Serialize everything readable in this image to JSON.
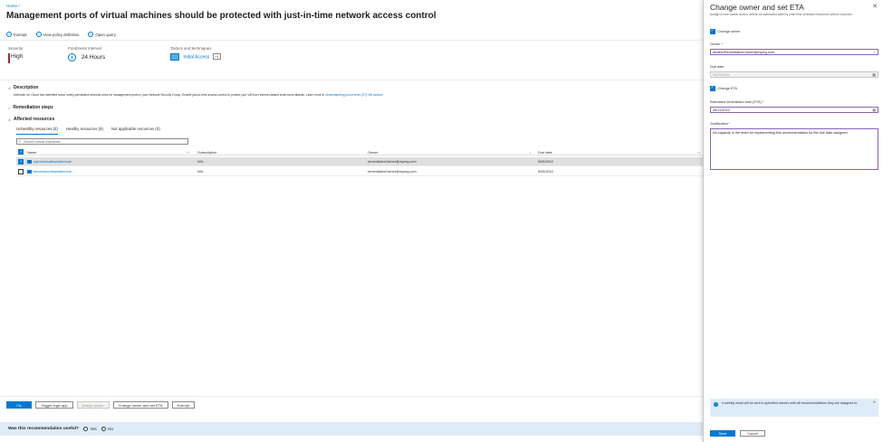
{
  "breadcrumb": "Home  /",
  "title": "Management ports of virtual machines should be protected with just-in-time network access control",
  "title_more": "...",
  "toolbar": {
    "exempt": "Exempt",
    "view_policy": "View policy definition",
    "open_query": "Open query"
  },
  "meta": {
    "severity_label": "Severity",
    "severity_value": "High",
    "freshness_label": "Freshness interval",
    "freshness_value": "24 Hours",
    "tactics_label": "Tactics and techniques",
    "tactics_value": "Initial Access",
    "tactics_more": "+1"
  },
  "sections": {
    "description": "Description",
    "description_text": "Defender for Cloud has identified some overly-permissive inbound rules for management ports in your Network Security Group. Enable just-in-time access control to protect your VM from internet-based brute-force attacks. Learn more in",
    "description_link": "Understanding just-in-time (JIT) VM access",
    "remediation": "Remediation steps",
    "affected": "Affected resources"
  },
  "tabs": [
    {
      "label": "Unhealthy resources (2)"
    },
    {
      "label": "Healthy resources (8)"
    },
    {
      "label": "Not applicable resources (0)"
    }
  ],
  "search_placeholder": "Search virtual machines",
  "table": {
    "headers": {
      "name": "Name",
      "subscription": "Subscription",
      "owner": "Owner",
      "due_date": "Due date"
    },
    "rows": [
      {
        "name": "sqlvmtoavailsanothersub",
        "subscription": "N/A",
        "owner": "remediationOwner@myorg.com",
        "due_date": "5/26/2022",
        "selected": true
      },
      {
        "name": "bevmimportinanothersub",
        "subscription": "N/A",
        "owner": "remediationOwner@myorg.com",
        "due_date": "5/26/2022",
        "selected": false
      }
    ]
  },
  "actions": {
    "fix": "Fix",
    "trigger": "Trigger logic app",
    "assign": "Assign owner",
    "change": "Change owner and set ETA",
    "exempt": "Exempt"
  },
  "feedback": {
    "question": "Was this recommendation useful?",
    "yes": "Yes",
    "no": "No"
  },
  "panel": {
    "title": "Change owner and set ETA",
    "subtitle": "Assign a new owner and/or define an estimated date by when the selected resources will be resolved.",
    "change_owner_label": "Change owner",
    "owner_label": "Owner",
    "owner_value": "anotherRemediationOwner@myorg.com",
    "due_date_label": "Due date",
    "due_date_value": "05/26/2022",
    "change_eta_label": "Change ETA",
    "eta_label": "Estimated remediation time (ETA)",
    "eta_value": "06/11/2022",
    "justification_label": "Justification",
    "justification_value": "No capacity in the team for implementing this recommendation by the due date assigned",
    "info_text": "A weekly email will be sent to specified owners with all recommendations they are assigned to.",
    "save": "Save",
    "cancel": "Cancel"
  },
  "colors": {
    "accent": "#0078d4",
    "severity_high": "#a4262c",
    "focus_border": "#8764b8",
    "info_bg": "#deecf9"
  }
}
